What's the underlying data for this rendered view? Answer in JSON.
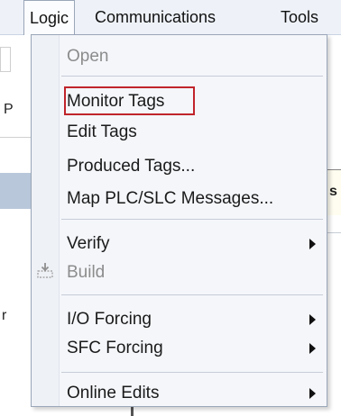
{
  "menubar": {
    "items": [
      {
        "label": "Logic",
        "active": true
      },
      {
        "label": "Communications",
        "active": false
      },
      {
        "label": "Tools",
        "active": false
      }
    ]
  },
  "background": {
    "fragment_p": "P",
    "fragment_r": "r",
    "fragment_s": "s"
  },
  "menu": {
    "items": [
      {
        "label": "Open",
        "disabled": true
      },
      {
        "label": "Monitor Tags",
        "highlighted": true
      },
      {
        "label": "Edit Tags"
      },
      {
        "label": "Produced Tags..."
      },
      {
        "label": "Map PLC/SLC Messages..."
      },
      {
        "label": "Verify",
        "submenu": true
      },
      {
        "label": "Build",
        "disabled": true,
        "icon": "build-icon"
      },
      {
        "label": "I/O Forcing",
        "submenu": true
      },
      {
        "label": "SFC Forcing",
        "submenu": true
      },
      {
        "label": "Online Edits",
        "submenu": true
      }
    ]
  },
  "colors": {
    "highlight_outline": "#c0242b",
    "menu_background": "#f4f6fa",
    "disabled_text": "#8c8c8c"
  }
}
